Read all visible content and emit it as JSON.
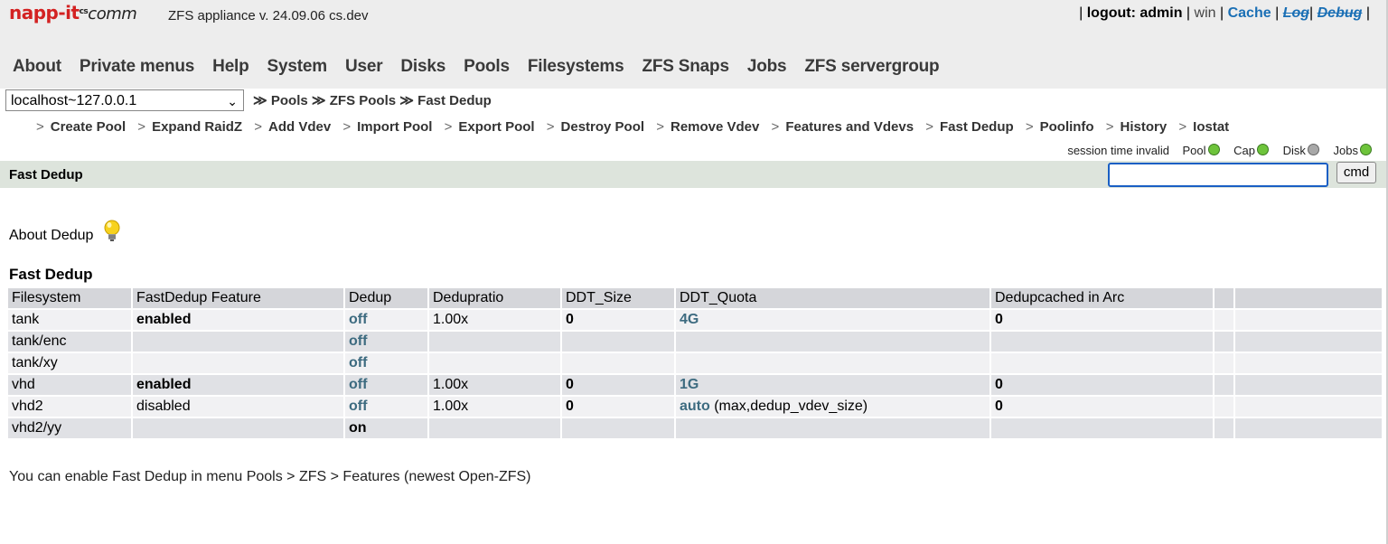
{
  "logo": {
    "part1": "napp-it",
    "part2": "comm",
    "part3": "cs"
  },
  "app_version": "ZFS appliance v. 24.09.06 cs.dev",
  "user_links": {
    "logout": "logout: admin",
    "win": "win",
    "cache": "Cache",
    "log": "Log",
    "debug": "Debug"
  },
  "main_menu": [
    "About",
    "Private menus",
    "Help",
    "System",
    "User",
    "Disks",
    "Pools",
    "Filesystems",
    "ZFS Snaps",
    "Jobs",
    "ZFS servergroup"
  ],
  "host_select": {
    "value": "localhost~127.0.0.1"
  },
  "breadcrumb": [
    "Pools",
    "ZFS Pools",
    "Fast Dedup"
  ],
  "breadcrumb_sep": "≫",
  "sub_menu": [
    "Create Pool",
    "Expand RaidZ",
    "Add Vdev",
    "Import Pool",
    "Export Pool",
    "Destroy Pool",
    "Remove Vdev",
    "Features and Vdevs",
    "Fast Dedup",
    "Poolinfo",
    "History",
    "Iostat"
  ],
  "sub_menu_arrow": ">",
  "status": {
    "session": "session time invalid",
    "pool": "Pool",
    "cap": "Cap",
    "disk": "Disk",
    "jobs": "Jobs"
  },
  "page_title": "Fast Dedup",
  "cmd_button": "cmd",
  "about_label": "About Dedup",
  "section_title": "Fast Dedup",
  "table": {
    "headers": [
      "Filesystem",
      "FastDedup Feature",
      "Dedup",
      "Dedupratio",
      "DDT_Size",
      "DDT_Quota",
      "Dedupcached in Arc",
      "",
      ""
    ],
    "rows": [
      [
        "tank",
        "enabled",
        "off",
        "1.00x",
        "0",
        "4G",
        "",
        "0"
      ],
      [
        "tank/enc",
        "",
        "off",
        "",
        "",
        "",
        "",
        ""
      ],
      [
        "tank/xy",
        "",
        "off",
        "",
        "",
        "",
        "",
        ""
      ],
      [
        "vhd",
        "enabled",
        "off",
        "1.00x",
        "0",
        "1G",
        "",
        "0"
      ],
      [
        "vhd2",
        "disabled",
        "off",
        "1.00x",
        "0",
        "auto",
        " (max,dedup_vdev_size)",
        "0"
      ],
      [
        "vhd2/yy",
        "",
        "on",
        "",
        "",
        "",
        "",
        ""
      ]
    ]
  },
  "footer_note": "You can enable Fast Dedup in menu Pools > ZFS > Features (newest Open-ZFS)"
}
